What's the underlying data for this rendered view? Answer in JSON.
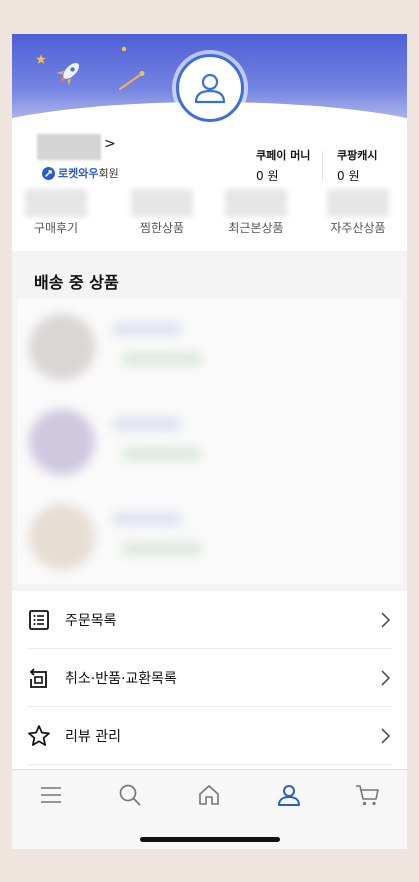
{
  "profile": {
    "chevron": ">",
    "membership_brand": "로켓와우",
    "membership_suffix": "회원",
    "balances": [
      {
        "label": "쿠페이 머니",
        "value": "0 원"
      },
      {
        "label": "쿠팡캐시",
        "value": "0 원"
      }
    ]
  },
  "shortcuts": [
    "구매후기",
    "찜한상품",
    "최근본상품",
    "자주산상품"
  ],
  "shipping": {
    "title": "배송 중 상품"
  },
  "menu": [
    {
      "label": "주문목록",
      "icon": "list-icon"
    },
    {
      "label": "취소·반품·교환목록",
      "icon": "return-icon"
    },
    {
      "label": "리뷰 관리",
      "icon": "star-icon"
    }
  ],
  "tabbar": [
    "menu-icon",
    "search-icon",
    "home-icon",
    "profile-icon",
    "cart-icon"
  ],
  "colors": {
    "accent": "#2b5cc9",
    "header_top": "#4f5fd6",
    "background": "#efe5de"
  }
}
